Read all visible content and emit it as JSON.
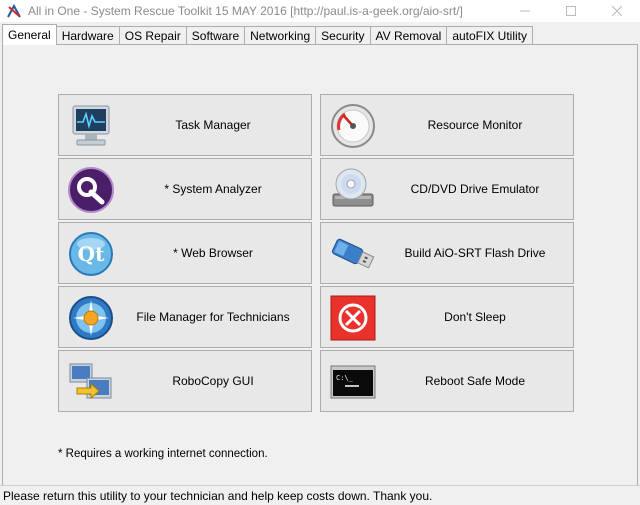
{
  "window": {
    "title": "All in One - System Rescue Toolkit 15 MAY 2016 [http://paul.is-a-geek.org/aio-srt/]"
  },
  "tabs": [
    {
      "label": "General",
      "active": true
    },
    {
      "label": "Hardware"
    },
    {
      "label": "OS Repair"
    },
    {
      "label": "Software"
    },
    {
      "label": "Networking"
    },
    {
      "label": "Security"
    },
    {
      "label": "AV Removal"
    },
    {
      "label": "autoFIX Utility"
    }
  ],
  "tools": {
    "left": [
      {
        "label": "Task Manager",
        "icon": "task-manager-icon"
      },
      {
        "label": "* System Analyzer",
        "icon": "system-analyzer-icon"
      },
      {
        "label": "* Web Browser",
        "icon": "qt-browser-icon"
      },
      {
        "label": "File Manager for Technicians",
        "icon": "compass-icon"
      },
      {
        "label": "RoboCopy GUI",
        "icon": "robocopy-icon"
      }
    ],
    "right": [
      {
        "label": "Resource Monitor",
        "icon": "gauge-icon"
      },
      {
        "label": "CD/DVD Drive Emulator",
        "icon": "cd-drive-icon"
      },
      {
        "label": "Build AiO-SRT Flash Drive",
        "icon": "usb-drive-icon"
      },
      {
        "label": "Don't Sleep",
        "icon": "dont-sleep-icon"
      },
      {
        "label": "Reboot Safe Mode",
        "icon": "console-icon"
      }
    ]
  },
  "footnote": "* Requires a working internet connection.",
  "status": "Please return this utility to your technician and help keep costs down.  Thank you.",
  "colors": {
    "accent_purple": "#5b2a7a",
    "dont_sleep_red": "#e8322b",
    "qt_blue": "#3a8fd0"
  }
}
